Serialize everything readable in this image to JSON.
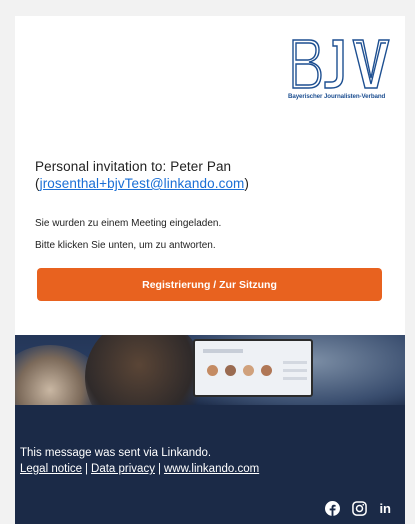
{
  "logo": {
    "mark": "BJV",
    "subtitle": "Bayerischer Journalisten-Verband",
    "color": "#1d4f91"
  },
  "invitation": {
    "title": "Personal invitation to: Peter Pan",
    "email_prefix": "(",
    "email": "jrosenthal+bjvTest@linkando.com",
    "email_suffix": ")"
  },
  "messages": {
    "line1": "Sie wurden zu einem Meeting eingeladen.",
    "line2": "Bitte klicken Sie unten, um zu antworten."
  },
  "cta": {
    "label": "Registrierung / Zur Sitzung",
    "color": "#e8621f"
  },
  "footer": {
    "sent_via": "This message was sent via Linkando.",
    "links": [
      "Legal notice",
      "Data privacy",
      "www.linkando.com"
    ],
    "separator": "|",
    "background": "#1b2a47",
    "social_icons": [
      "facebook-icon",
      "instagram-icon",
      "linkedin-icon"
    ],
    "linkedin_glyph": "in"
  }
}
